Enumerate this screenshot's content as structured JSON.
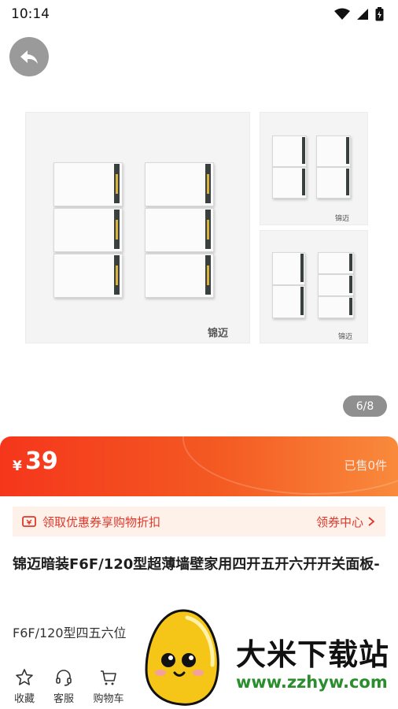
{
  "status_bar": {
    "time": "10:14"
  },
  "gallery": {
    "counter": "6/8",
    "brand_main": "锦迈",
    "brand_small": "锦迈"
  },
  "price": {
    "currency": "¥",
    "value": "39",
    "sold": "已售0件"
  },
  "coupon": {
    "label": "领取优惠券享购物折扣",
    "action": "领券中心"
  },
  "product": {
    "title": "锦迈暗装F6F/120型超薄墙壁家用四开五开六开开关面板-",
    "spec": "F6F/120型四五六位"
  },
  "bottom_bar": {
    "favorite": "收藏",
    "service": "客服",
    "cart": "购物车"
  },
  "watermark": {
    "name": "大米下载站",
    "url": "www.zzhyw.com"
  },
  "colors": {
    "accent": "#f5361c",
    "coupon_text": "#e0382a",
    "watermark_url": "#2a8e2d"
  }
}
